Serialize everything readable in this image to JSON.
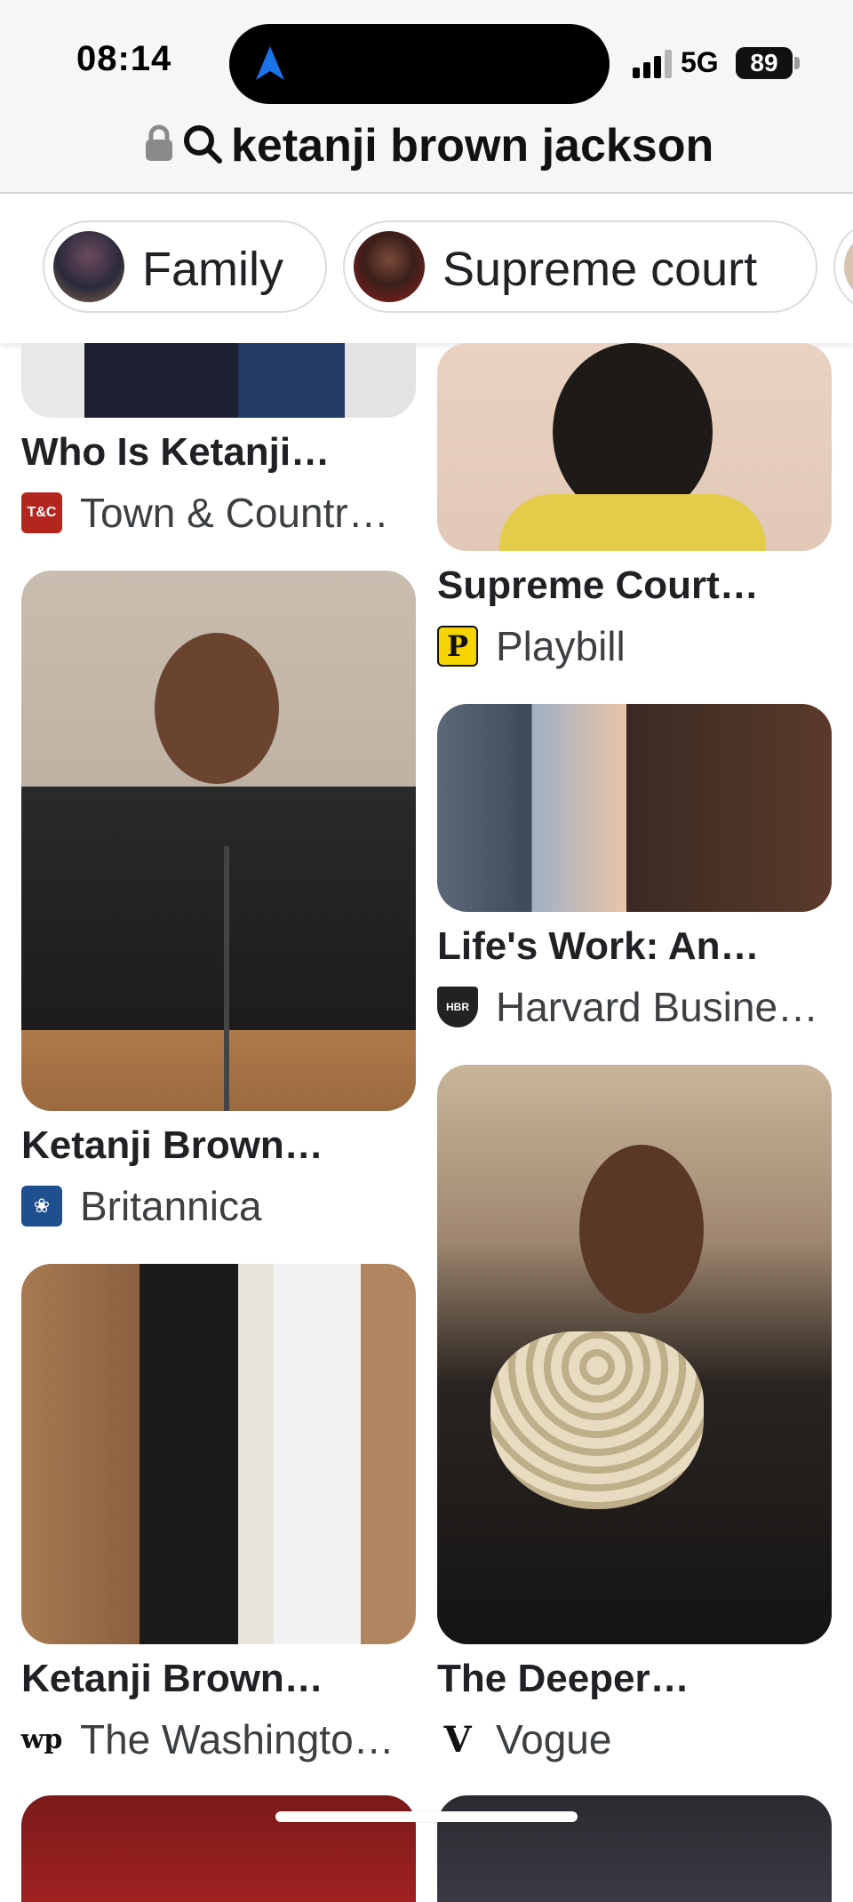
{
  "status_bar": {
    "time": "08:14",
    "network": "5G",
    "battery": "89"
  },
  "address_bar": {
    "query": "ketanji brown jackson"
  },
  "chips": [
    {
      "label": "Family"
    },
    {
      "label": "Supreme court"
    }
  ],
  "results": [
    {
      "title": "Who Is Ketanji…",
      "source": "Town & Countr…",
      "favicon_text": "T&C"
    },
    {
      "title": "Supreme Court…",
      "source": "Playbill",
      "favicon_text": "P"
    },
    {
      "title": "Life's Work: An…",
      "source": "Harvard Busine…",
      "favicon_text": "HBR"
    },
    {
      "title": "Ketanji Brown…",
      "source": "Britannica",
      "favicon_text": ""
    },
    {
      "title": "Ketanji Brown…",
      "source": "The Washingto…",
      "favicon_text": "wp"
    },
    {
      "title": "The Deeper…",
      "source": "Vogue",
      "favicon_text": "V"
    }
  ]
}
